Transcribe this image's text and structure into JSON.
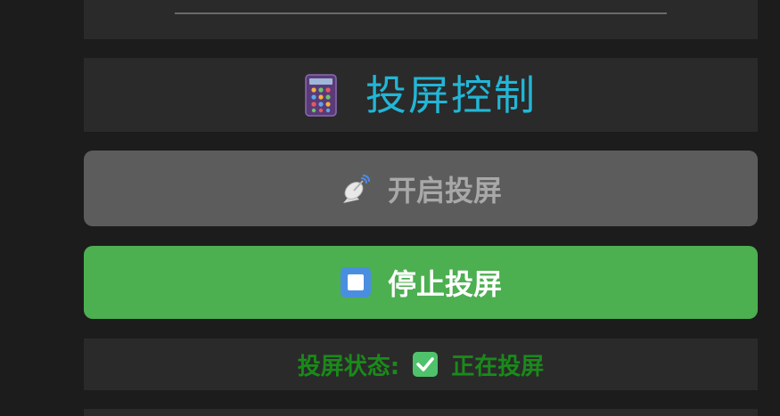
{
  "section": {
    "title": "投屏控制",
    "title_icon": "calculator-phone-icon"
  },
  "buttons": {
    "start": {
      "label": "开启投屏",
      "icon": "satellite-dish-icon",
      "enabled": false
    },
    "stop": {
      "label": "停止投屏",
      "icon": "stop-square-icon",
      "enabled": true
    }
  },
  "status": {
    "label": "投屏状态:",
    "icon": "check-mark-icon",
    "value": "正在投屏"
  },
  "colors": {
    "background": "#1c1c1c",
    "panel": "#2a2a2a",
    "title": "#22b6d6",
    "stop_button": "#4caf50",
    "start_button_disabled": "#5c5c5c",
    "status_text": "#1a8a1a"
  }
}
